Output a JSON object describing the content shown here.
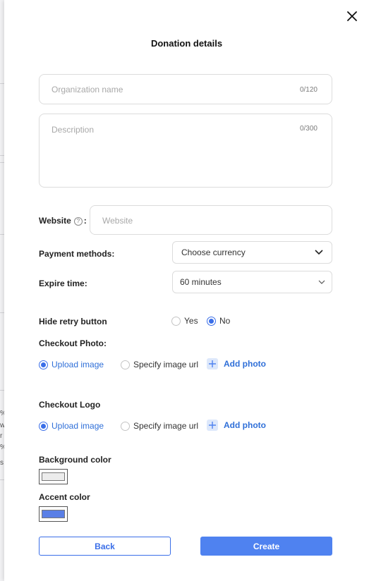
{
  "dialog": {
    "title": "Donation details",
    "close_icon": "close-icon"
  },
  "organization": {
    "placeholder": "Organization name",
    "counter": "0/120"
  },
  "description": {
    "placeholder": "Description",
    "counter": "0/300"
  },
  "website": {
    "label": "Website",
    "colon": ":",
    "placeholder": "Website"
  },
  "payment_methods": {
    "label": "Payment methods:",
    "value": "Choose currency"
  },
  "expire_time": {
    "label": "Expire time:",
    "value": "60 minutes"
  },
  "hide_retry": {
    "label": "Hide retry button",
    "options": [
      "Yes",
      "No"
    ],
    "selected": "No"
  },
  "checkout_photo": {
    "label": "Checkout Photo:",
    "options": [
      "Upload image",
      "Specify image url"
    ],
    "selected": "Upload image",
    "add_label": "Add photo"
  },
  "checkout_logo": {
    "label": "Checkout Logo",
    "options": [
      "Upload image",
      "Specify image url"
    ],
    "selected": "Upload image",
    "add_label": "Add photo"
  },
  "background_color": {
    "label": "Background color",
    "value": "#ececec"
  },
  "accent_color": {
    "label": "Accent color",
    "value": "#5a7fe6"
  },
  "actions": {
    "back": "Back",
    "create": "Create"
  },
  "backdrop_fragments": [
    "%",
    "w",
    "r",
    "%",
    "s"
  ],
  "colors": {
    "primary": "#4f82f0",
    "link": "#2f6fd8"
  }
}
